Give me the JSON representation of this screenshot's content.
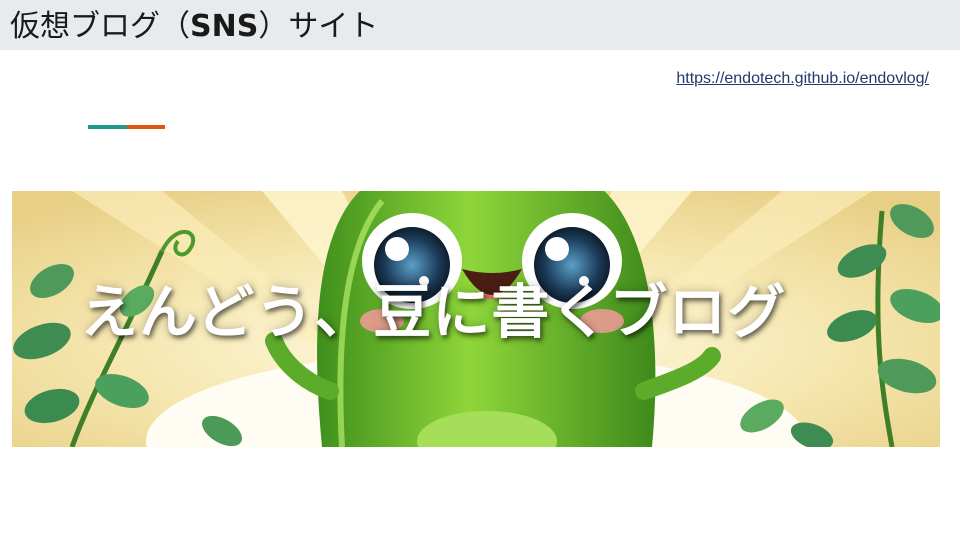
{
  "header": {
    "title_jp_prefix": "仮想ブログ（",
    "title_en": "SNS",
    "title_jp_suffix": "）サイト"
  },
  "link": {
    "url_text": "https://endotech.github.io/endovlog/"
  },
  "accent": {
    "teal": "#1e9a8a",
    "orange": "#e0560f"
  },
  "banner": {
    "text": "えんどう、豆に書くブログ",
    "icon": "pea-mascot"
  }
}
